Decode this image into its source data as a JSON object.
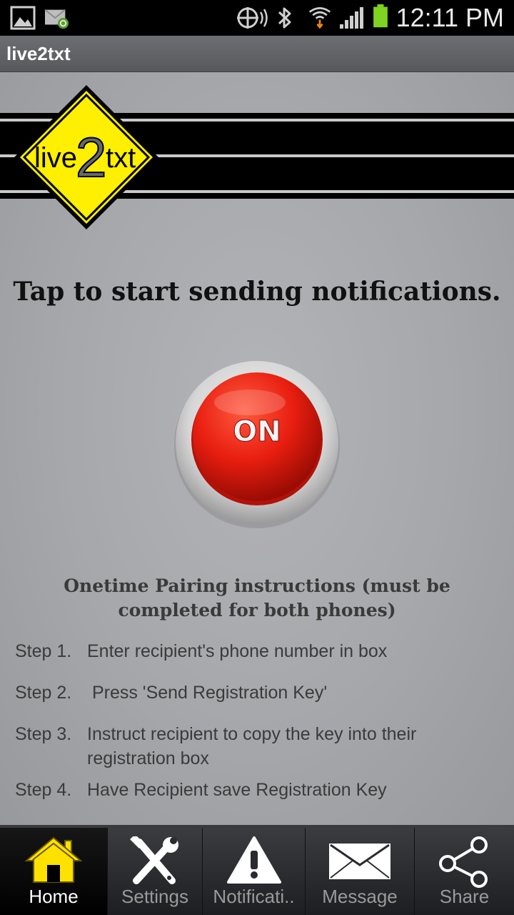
{
  "status_bar": {
    "time": "12:11 PM",
    "icons": [
      "gallery-icon",
      "email-sync-icon",
      "gps-icon",
      "bluetooth-icon",
      "wifi-icon",
      "signal-icon",
      "battery-icon"
    ]
  },
  "app": {
    "title": "live2txt"
  },
  "logo": {
    "text_left": "live",
    "text_mid": "2",
    "text_right": "txt",
    "color": "#ffef00"
  },
  "main": {
    "headline": "Tap to start sending notifications.",
    "button_label": "ON",
    "button_color": "#e81e10",
    "pairing_title": "Onetime Pairing instructions (must be completed for both phones)",
    "steps": [
      {
        "num": "Step 1.",
        "text": "Enter recipient's phone number in box"
      },
      {
        "num": "Step 2.",
        "text": " Press 'Send Registration Key'"
      },
      {
        "num": "Step 3.",
        "text": "Instruct recipient to copy the key into their registration box"
      },
      {
        "num": "Step 4.",
        "text": "Have Recipient save Registration Key"
      }
    ]
  },
  "tabs": [
    {
      "label": "Home",
      "icon": "home-icon",
      "active": true
    },
    {
      "label": "Settings",
      "icon": "settings-tools-icon",
      "active": false
    },
    {
      "label": "Notificati..",
      "icon": "warning-icon",
      "active": false
    },
    {
      "label": "Message",
      "icon": "envelope-icon",
      "active": false
    },
    {
      "label": "Share",
      "icon": "share-icon",
      "active": false
    }
  ]
}
